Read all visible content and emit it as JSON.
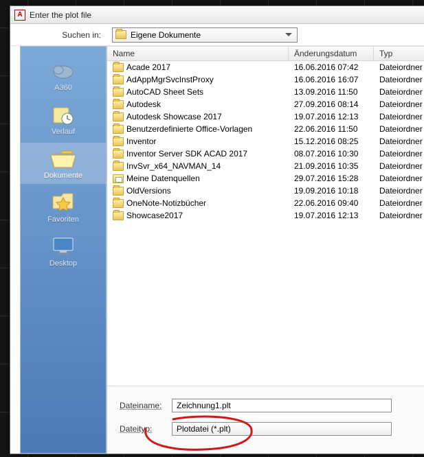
{
  "window": {
    "title": "Enter the plot file"
  },
  "toolbar": {
    "search_label": "Suchen in:",
    "current_folder": "Eigene Dokumente"
  },
  "places": [
    {
      "key": "a360",
      "label": "A360",
      "icon": "cloud"
    },
    {
      "key": "verlauf",
      "label": "Verlauf",
      "icon": "history"
    },
    {
      "key": "dokumente",
      "label": "Dokumente",
      "icon": "folder-open",
      "selected": true
    },
    {
      "key": "favoriten",
      "label": "Favoriten",
      "icon": "favorites"
    },
    {
      "key": "desktop",
      "label": "Desktop",
      "icon": "desktop"
    }
  ],
  "columns": {
    "name": "Name",
    "date": "Änderungsdatum",
    "type": "Typ"
  },
  "rows": [
    {
      "icon": "folder",
      "name": "Acade 2017",
      "date": "16.06.2016 07:42",
      "type": "Dateiordner"
    },
    {
      "icon": "folder",
      "name": "AdAppMgrSvcInstProxy",
      "date": "16.06.2016 16:07",
      "type": "Dateiordner"
    },
    {
      "icon": "folder",
      "name": "AutoCAD Sheet Sets",
      "date": "13.09.2016 11:50",
      "type": "Dateiordner"
    },
    {
      "icon": "folder",
      "name": "Autodesk",
      "date": "27.09.2016 08:14",
      "type": "Dateiordner"
    },
    {
      "icon": "folder",
      "name": "Autodesk Showcase 2017",
      "date": "19.07.2016 12:13",
      "type": "Dateiordner"
    },
    {
      "icon": "folder",
      "name": "Benutzerdefinierte Office-Vorlagen",
      "date": "22.06.2016 11:50",
      "type": "Dateiordner"
    },
    {
      "icon": "folder",
      "name": "Inventor",
      "date": "15.12.2016 08:25",
      "type": "Dateiordner"
    },
    {
      "icon": "folder",
      "name": "Inventor Server SDK ACAD 2017",
      "date": "08.07.2016 10:30",
      "type": "Dateiordner"
    },
    {
      "icon": "folder",
      "name": "InvSvr_x64_NAVMAN_14",
      "date": "21.09.2016 10:35",
      "type": "Dateiordner"
    },
    {
      "icon": "data-sources",
      "name": "Meine Datenquellen",
      "date": "29.07.2016 15:28",
      "type": "Dateiordner"
    },
    {
      "icon": "folder",
      "name": "OldVersions",
      "date": "19.09.2016 10:18",
      "type": "Dateiordner"
    },
    {
      "icon": "folder",
      "name": "OneNote-Notizbücher",
      "date": "22.06.2016 09:40",
      "type": "Dateiordner"
    },
    {
      "icon": "folder",
      "name": "Showcase2017",
      "date": "19.07.2016 12:13",
      "type": "Dateiordner"
    }
  ],
  "bottom": {
    "filename_label": "Dateiname:",
    "filename_value": "Zeichnung1.plt",
    "filetype_label": "Dateityp:",
    "filetype_value": "Plotdatei (*.plt)"
  }
}
